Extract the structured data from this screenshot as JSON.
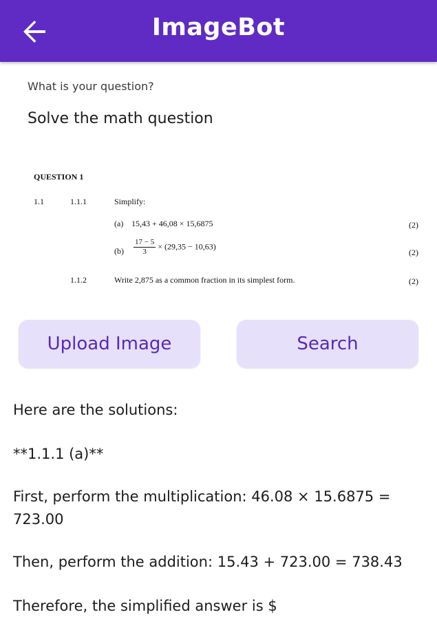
{
  "appbar": {
    "title": "ImageBot"
  },
  "question": {
    "label": "What is your question?",
    "value": "Solve the math question"
  },
  "document": {
    "heading": "QUESTION 1",
    "q_num": "1.1",
    "sub1_num": "1.1.1",
    "sub1_text": "Simplify:",
    "part_a_label": "(a)",
    "part_a_expr": "15,43 + 46,08 × 15,6875",
    "part_a_marks": "(2)",
    "part_b_label": "(b)",
    "part_b_num": "17 − 5",
    "part_b_den": "3",
    "part_b_rest": "× (29,35 − 10,63)",
    "part_b_marks": "(2)",
    "sub2_num": "1.1.2",
    "sub2_text": "Write  2,875  as a common fraction in its simplest form.",
    "sub2_marks": "(2)"
  },
  "buttons": {
    "upload": "Upload Image",
    "search": "Search"
  },
  "answer": {
    "p1": "Here are the solutions:",
    "p2": "**1.1.1 (a)**",
    "p3": "First, perform the multiplication: 46.08 × 15.6875 = 723.00",
    "p4": "Then, perform the addition: 15.43 + 723.00 = 738.43",
    "p5": "Therefore, the simplified answer is $"
  },
  "colors": {
    "primary": "#5f2bc4",
    "button_bg": "#e6e0fb",
    "button_text": "#5a29b8"
  },
  "icons": {
    "back": "arrow-left-icon"
  }
}
